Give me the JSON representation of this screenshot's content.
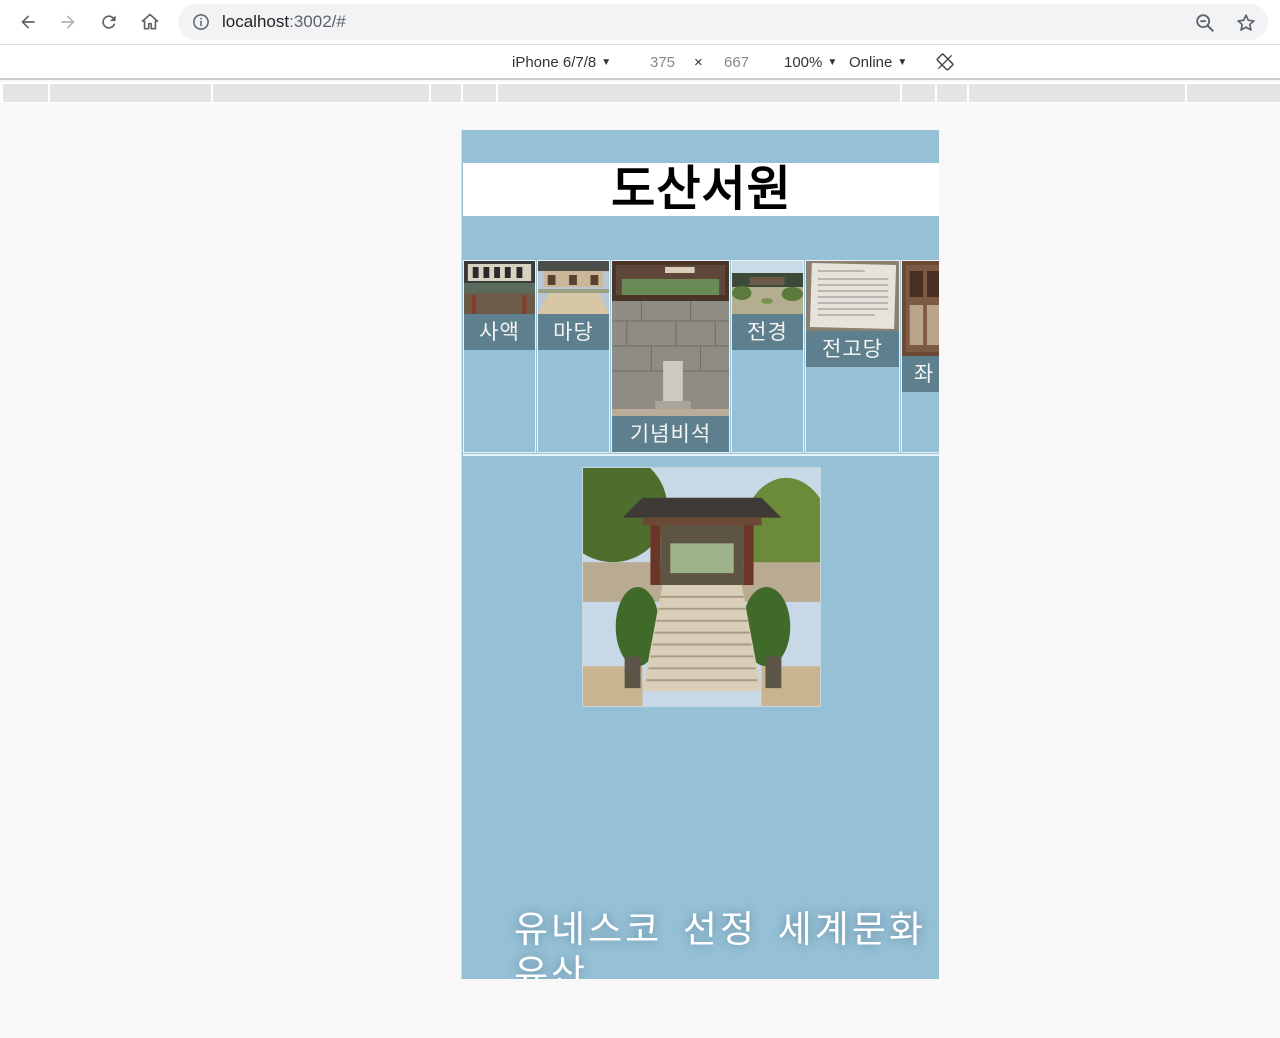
{
  "browser": {
    "url_host": "localhost",
    "url_path": ":3002/#"
  },
  "device_toolbar": {
    "device": "iPhone 6/7/8",
    "width": "375",
    "times": "×",
    "height": "667",
    "zoom": "100%",
    "network": "Online"
  },
  "page": {
    "title": "도산서원",
    "gallery": [
      {
        "caption": "사액"
      },
      {
        "caption": "마당"
      },
      {
        "caption": "기념비석"
      },
      {
        "caption": "전경"
      },
      {
        "caption": "전고당"
      },
      {
        "caption": "좌"
      }
    ],
    "headline": "유네스코 선정 세계문화유산"
  }
}
